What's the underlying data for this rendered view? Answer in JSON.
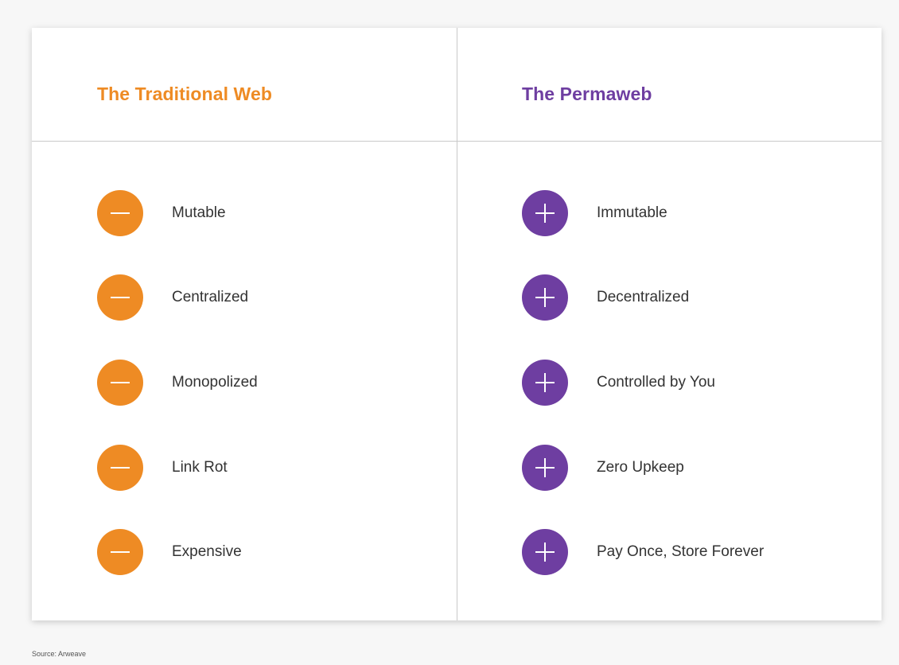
{
  "colors": {
    "traditional": "#ee8b24",
    "permaweb": "#6e3ea1"
  },
  "left": {
    "title": "The Traditional Web",
    "icon": "minus-icon",
    "items": [
      {
        "label": "Mutable"
      },
      {
        "label": "Centralized"
      },
      {
        "label": "Monopolized"
      },
      {
        "label": "Link Rot"
      },
      {
        "label": "Expensive"
      }
    ]
  },
  "right": {
    "title": "The Permaweb",
    "icon": "plus-icon",
    "items": [
      {
        "label": "Immutable"
      },
      {
        "label": "Decentralized"
      },
      {
        "label": "Controlled by You"
      },
      {
        "label": "Zero Upkeep"
      },
      {
        "label": "Pay Once, Store Forever"
      }
    ]
  },
  "source": "Source: Arweave"
}
